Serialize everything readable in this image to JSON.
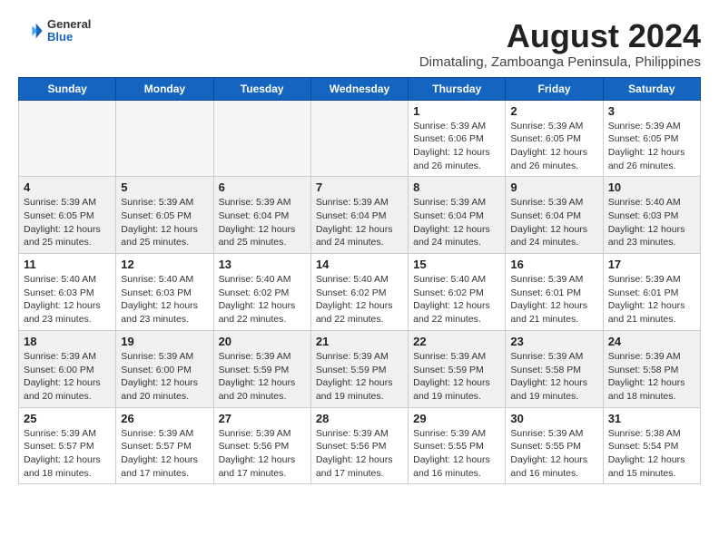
{
  "header": {
    "logo_general": "General",
    "logo_blue": "Blue",
    "main_title": "August 2024",
    "subtitle": "Dimataling, Zamboanga Peninsula, Philippines"
  },
  "weekdays": [
    "Sunday",
    "Monday",
    "Tuesday",
    "Wednesday",
    "Thursday",
    "Friday",
    "Saturday"
  ],
  "rows": [
    {
      "bg": "white",
      "cells": [
        {
          "day": "",
          "content": ""
        },
        {
          "day": "",
          "content": ""
        },
        {
          "day": "",
          "content": ""
        },
        {
          "day": "",
          "content": ""
        },
        {
          "day": "1",
          "content": "Sunrise: 5:39 AM\nSunset: 6:06 PM\nDaylight: 12 hours\nand 26 minutes."
        },
        {
          "day": "2",
          "content": "Sunrise: 5:39 AM\nSunset: 6:05 PM\nDaylight: 12 hours\nand 26 minutes."
        },
        {
          "day": "3",
          "content": "Sunrise: 5:39 AM\nSunset: 6:05 PM\nDaylight: 12 hours\nand 26 minutes."
        }
      ]
    },
    {
      "bg": "alt",
      "cells": [
        {
          "day": "4",
          "content": "Sunrise: 5:39 AM\nSunset: 6:05 PM\nDaylight: 12 hours\nand 25 minutes."
        },
        {
          "day": "5",
          "content": "Sunrise: 5:39 AM\nSunset: 6:05 PM\nDaylight: 12 hours\nand 25 minutes."
        },
        {
          "day": "6",
          "content": "Sunrise: 5:39 AM\nSunset: 6:04 PM\nDaylight: 12 hours\nand 25 minutes."
        },
        {
          "day": "7",
          "content": "Sunrise: 5:39 AM\nSunset: 6:04 PM\nDaylight: 12 hours\nand 24 minutes."
        },
        {
          "day": "8",
          "content": "Sunrise: 5:39 AM\nSunset: 6:04 PM\nDaylight: 12 hours\nand 24 minutes."
        },
        {
          "day": "9",
          "content": "Sunrise: 5:39 AM\nSunset: 6:04 PM\nDaylight: 12 hours\nand 24 minutes."
        },
        {
          "day": "10",
          "content": "Sunrise: 5:40 AM\nSunset: 6:03 PM\nDaylight: 12 hours\nand 23 minutes."
        }
      ]
    },
    {
      "bg": "white",
      "cells": [
        {
          "day": "11",
          "content": "Sunrise: 5:40 AM\nSunset: 6:03 PM\nDaylight: 12 hours\nand 23 minutes."
        },
        {
          "day": "12",
          "content": "Sunrise: 5:40 AM\nSunset: 6:03 PM\nDaylight: 12 hours\nand 23 minutes."
        },
        {
          "day": "13",
          "content": "Sunrise: 5:40 AM\nSunset: 6:02 PM\nDaylight: 12 hours\nand 22 minutes."
        },
        {
          "day": "14",
          "content": "Sunrise: 5:40 AM\nSunset: 6:02 PM\nDaylight: 12 hours\nand 22 minutes."
        },
        {
          "day": "15",
          "content": "Sunrise: 5:40 AM\nSunset: 6:02 PM\nDaylight: 12 hours\nand 22 minutes."
        },
        {
          "day": "16",
          "content": "Sunrise: 5:39 AM\nSunset: 6:01 PM\nDaylight: 12 hours\nand 21 minutes."
        },
        {
          "day": "17",
          "content": "Sunrise: 5:39 AM\nSunset: 6:01 PM\nDaylight: 12 hours\nand 21 minutes."
        }
      ]
    },
    {
      "bg": "alt",
      "cells": [
        {
          "day": "18",
          "content": "Sunrise: 5:39 AM\nSunset: 6:00 PM\nDaylight: 12 hours\nand 20 minutes."
        },
        {
          "day": "19",
          "content": "Sunrise: 5:39 AM\nSunset: 6:00 PM\nDaylight: 12 hours\nand 20 minutes."
        },
        {
          "day": "20",
          "content": "Sunrise: 5:39 AM\nSunset: 5:59 PM\nDaylight: 12 hours\nand 20 minutes."
        },
        {
          "day": "21",
          "content": "Sunrise: 5:39 AM\nSunset: 5:59 PM\nDaylight: 12 hours\nand 19 minutes."
        },
        {
          "day": "22",
          "content": "Sunrise: 5:39 AM\nSunset: 5:59 PM\nDaylight: 12 hours\nand 19 minutes."
        },
        {
          "day": "23",
          "content": "Sunrise: 5:39 AM\nSunset: 5:58 PM\nDaylight: 12 hours\nand 19 minutes."
        },
        {
          "day": "24",
          "content": "Sunrise: 5:39 AM\nSunset: 5:58 PM\nDaylight: 12 hours\nand 18 minutes."
        }
      ]
    },
    {
      "bg": "white",
      "cells": [
        {
          "day": "25",
          "content": "Sunrise: 5:39 AM\nSunset: 5:57 PM\nDaylight: 12 hours\nand 18 minutes."
        },
        {
          "day": "26",
          "content": "Sunrise: 5:39 AM\nSunset: 5:57 PM\nDaylight: 12 hours\nand 17 minutes."
        },
        {
          "day": "27",
          "content": "Sunrise: 5:39 AM\nSunset: 5:56 PM\nDaylight: 12 hours\nand 17 minutes."
        },
        {
          "day": "28",
          "content": "Sunrise: 5:39 AM\nSunset: 5:56 PM\nDaylight: 12 hours\nand 17 minutes."
        },
        {
          "day": "29",
          "content": "Sunrise: 5:39 AM\nSunset: 5:55 PM\nDaylight: 12 hours\nand 16 minutes."
        },
        {
          "day": "30",
          "content": "Sunrise: 5:39 AM\nSunset: 5:55 PM\nDaylight: 12 hours\nand 16 minutes."
        },
        {
          "day": "31",
          "content": "Sunrise: 5:38 AM\nSunset: 5:54 PM\nDaylight: 12 hours\nand 15 minutes."
        }
      ]
    }
  ]
}
